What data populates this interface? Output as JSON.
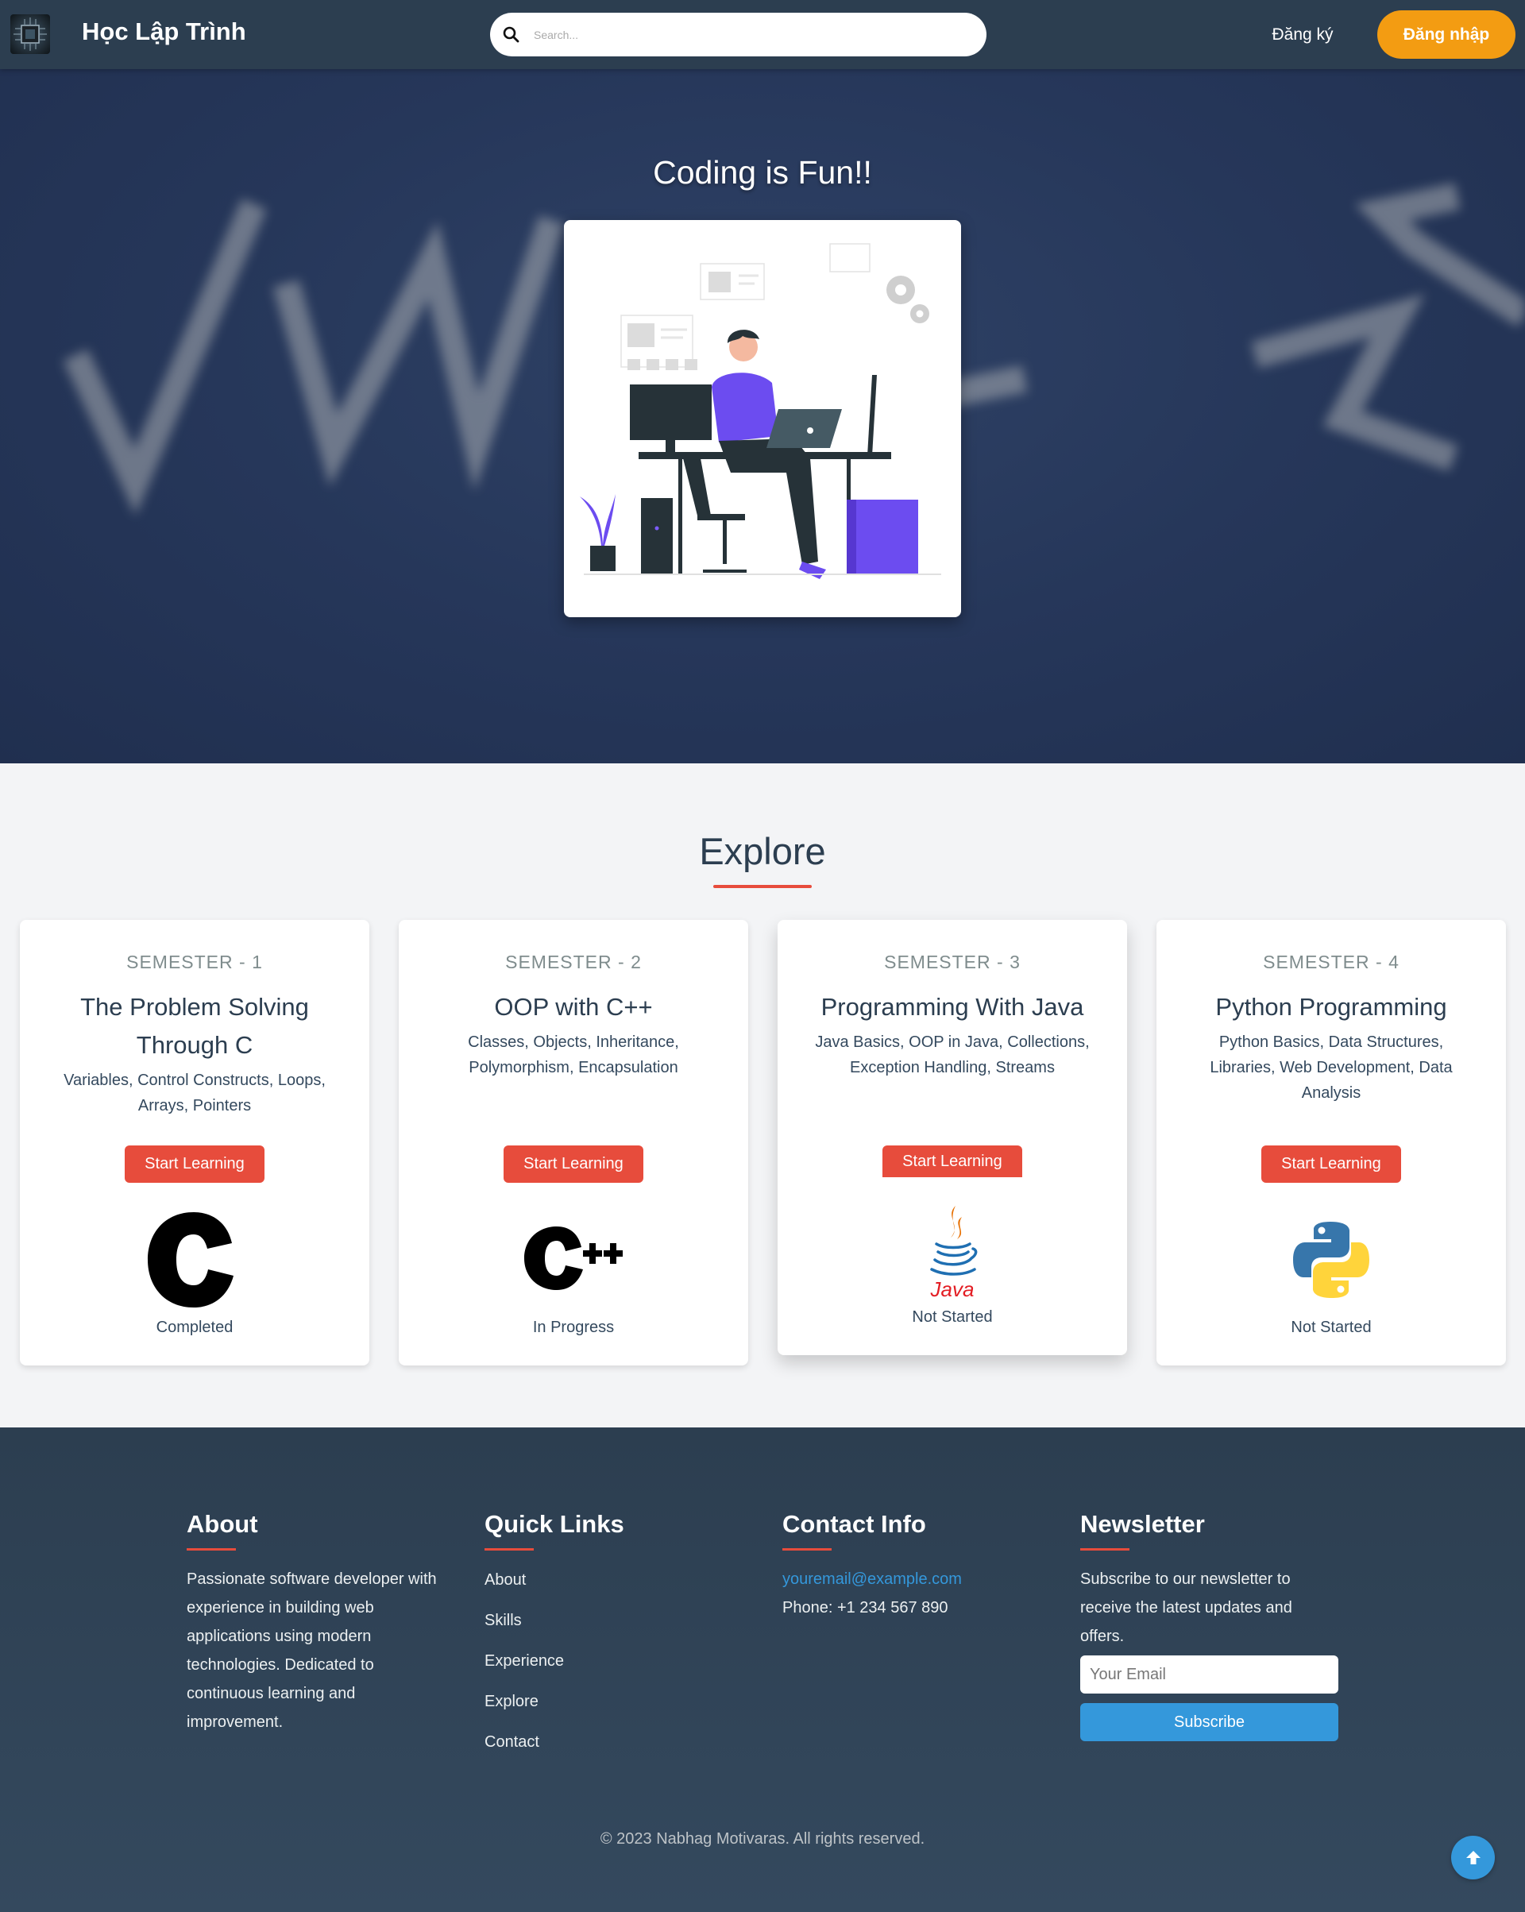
{
  "navbar": {
    "brand": "Học Lập Trình",
    "logo_icon": "circuit-chip-icon",
    "search_placeholder": "Search...",
    "register_label": "Đăng ký",
    "login_label": "Đăng nhập",
    "login_color": "#f39c12"
  },
  "hero": {
    "title": "Coding is Fun!!",
    "illustration": "developer-at-desk-illustration"
  },
  "explore": {
    "title": "Explore",
    "accent_color": "#e74c3c",
    "cards": [
      {
        "semester": "SEMESTER - 1",
        "title": "The Problem Solving Through C",
        "description": "Variables, Control Constructs, Loops, Arrays, Pointers",
        "button": "Start Learning",
        "logo": "c-language-icon",
        "status": "Completed"
      },
      {
        "semester": "SEMESTER - 2",
        "title": "OOP with C++",
        "description": "Classes, Objects, Inheritance, Polymorphism, Encapsulation",
        "button": "Start Learning",
        "logo": "cpp-language-icon",
        "status": "In Progress"
      },
      {
        "semester": "SEMESTER - 3",
        "title": "Programming With Java",
        "description": "Java Basics, OOP in Java, Collections, Exception Handling, Streams",
        "button": "Start Learning",
        "logo": "java-icon",
        "logo_text": "Java",
        "status": "Not Started"
      },
      {
        "semester": "SEMESTER - 4",
        "title": "Python Programming",
        "description": "Python Basics, Data Structures, Libraries, Web Development, Data Analysis",
        "button": "Start Learning",
        "logo": "python-icon",
        "status": "Not Started"
      }
    ]
  },
  "footer": {
    "about": {
      "heading": "About",
      "text": "Passionate software developer with experience in building web applications using modern technologies. Dedicated to continuous learning and improvement."
    },
    "quick_links": {
      "heading": "Quick Links",
      "items": [
        "About",
        "Skills",
        "Experience",
        "Explore",
        "Contact"
      ]
    },
    "contact": {
      "heading": "Contact Info",
      "email": "youremail@example.com",
      "phone": "Phone: +1 234 567 890"
    },
    "newsletter": {
      "heading": "Newsletter",
      "text": "Subscribe to our newsletter to receive the latest updates and offers.",
      "placeholder": "Your Email",
      "button": "Subscribe"
    },
    "copyright": "© 2023 Nabhag Motivaras. All rights reserved.",
    "scroll_top_icon": "arrow-up-icon"
  }
}
